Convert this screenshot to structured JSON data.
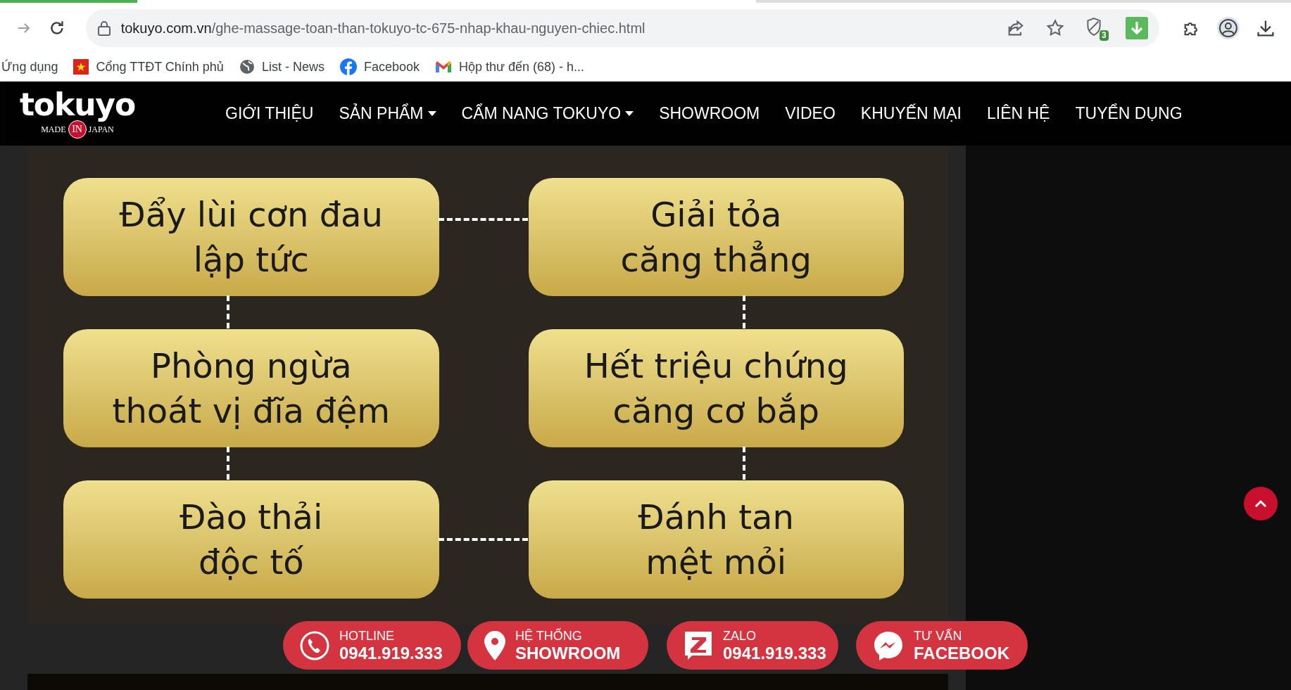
{
  "browser": {
    "url_domain": "tokuyo.com.vn",
    "url_path": "/ghe-massage-toan-than-tokuyo-tc-675-nhap-khau-nguyen-chiec.html",
    "extension_badge": "3",
    "bookmarks": [
      {
        "kind": "apps",
        "label": "Ứng dụng"
      },
      {
        "kind": "flag",
        "label": "Cổng TTĐT Chính phủ"
      },
      {
        "kind": "globe",
        "label": "List - News"
      },
      {
        "kind": "facebook",
        "label": "Facebook"
      },
      {
        "kind": "mail",
        "label": "Hộp thư đến (68) - h..."
      }
    ]
  },
  "site": {
    "logo": {
      "name": "tokuyo",
      "made": "MADE",
      "in": "IN",
      "japan": "JAPAN"
    },
    "nav": [
      {
        "label": "GIỚI THIỆU",
        "dropdown": false
      },
      {
        "label": "SẢN PHẨM",
        "dropdown": true
      },
      {
        "label": "CẨM NANG TOKUYO",
        "dropdown": true
      },
      {
        "label": "SHOWROOM",
        "dropdown": false
      },
      {
        "label": "VIDEO",
        "dropdown": false
      },
      {
        "label": "KHUYẾN MẠI",
        "dropdown": false
      },
      {
        "label": "LIÊN HỆ",
        "dropdown": false
      },
      {
        "label": "TUYỂN DỤNG",
        "dropdown": false
      }
    ]
  },
  "benefits": [
    {
      "lines": [
        "Đẩy lùi cơn đau",
        "lập tức"
      ]
    },
    {
      "lines": [
        "Giải tỏa",
        "căng thẳng"
      ]
    },
    {
      "lines": [
        "Phòng ngừa",
        "thoát vị đĩa đệm"
      ]
    },
    {
      "lines": [
        "Hết triệu chứng",
        "căng cơ bắp"
      ]
    },
    {
      "lines": [
        "Đào thải",
        "độc tố"
      ]
    },
    {
      "lines": [
        "Đánh tan",
        "mệt mỏi"
      ]
    }
  ],
  "contact_buttons": [
    {
      "kind": "phone",
      "label": "HOTLINE",
      "value": "0941.919.333"
    },
    {
      "kind": "pin",
      "label": "HỆ THỐNG",
      "value": "SHOWROOM"
    },
    {
      "kind": "zalo",
      "label": "ZALO",
      "value": "0941.919.333"
    },
    {
      "kind": "messenger",
      "label": "TƯ VẤN",
      "value": "FACEBOOK"
    }
  ]
}
